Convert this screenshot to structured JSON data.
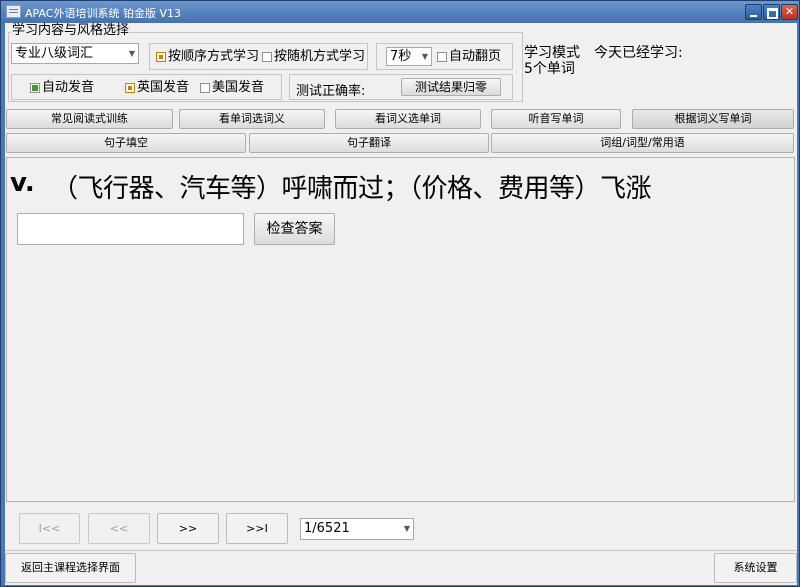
{
  "window": {
    "title": "APAC外语培训系统 铂金版 V13"
  },
  "settings": {
    "group_label": "学习内容与风格选择",
    "vocab_select": "专业八级词汇",
    "order_label": "按顺序方式学习",
    "random_label": "按随机方式学习",
    "interval_select": "7秒",
    "auto_flip_label": "自动翻页",
    "auto_pron_label": "自动发音",
    "british_label": "英国发音",
    "american_label": "美国发音",
    "accuracy_label": "测试正确率:",
    "reset_label": "测试结果归零",
    "mode_label": "学习模式",
    "today_label": "今天已经学习:",
    "today_count": "5个单词"
  },
  "modes": {
    "row1": [
      "常见阅读式训练",
      "看单词选词义",
      "看词义选单词",
      "听音写单词",
      "根据词义写单词"
    ],
    "row2": [
      "句子填空",
      "句子翻译",
      "词组/词型/常用语"
    ]
  },
  "question": {
    "pos": "v.",
    "definition": "（飞行器、汽车等）呼啸而过；（价格、费用等）飞涨",
    "answer_value": "",
    "check_label": "检查答案"
  },
  "pager": {
    "first": "I<<",
    "prev": "<<",
    "next": ">>",
    "last": ">>I",
    "page_select": "1/6521"
  },
  "footer": {
    "back_label": "返回主课程选择界面",
    "settings_label": "系统设置"
  }
}
